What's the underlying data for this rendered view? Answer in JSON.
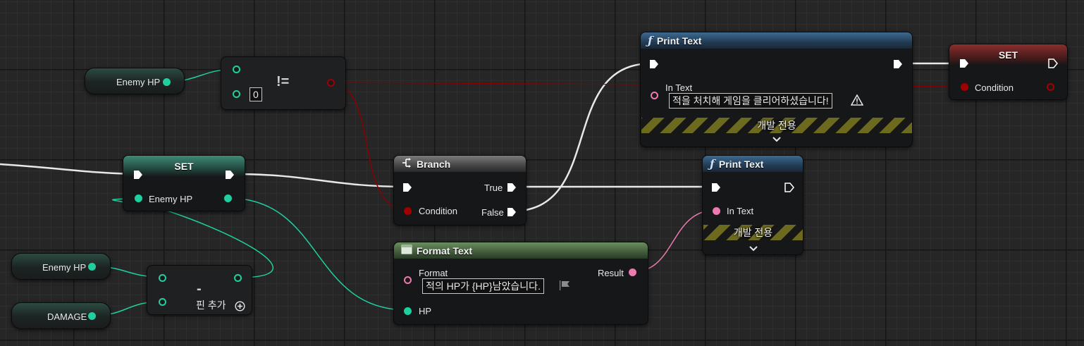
{
  "nodes": {
    "get_enemy_hp_top": {
      "label": "Enemy HP"
    },
    "not_equal": {
      "symbol": "!=",
      "b_value": "0"
    },
    "print_text_top": {
      "title": "Print Text",
      "in_text_label": "In Text",
      "in_text_value": "적을 처치해 게임을 클리어하셨습니다!",
      "dev_only": "개발 전용",
      "icon": "warning-icon"
    },
    "set_condition": {
      "title": "SET",
      "pin_label": "Condition"
    },
    "set_enemy_hp": {
      "title": "SET",
      "pin_label": "Enemy HP"
    },
    "branch": {
      "title": "Branch",
      "condition_label": "Condition",
      "true_label": "True",
      "false_label": "False"
    },
    "print_text_bottom": {
      "title": "Print Text",
      "in_text_label": "In Text",
      "dev_only": "개발 전용"
    },
    "format_text": {
      "title": "Format Text",
      "format_label": "Format",
      "format_value": "적의 HP가 {HP}남았습니다.",
      "result_label": "Result",
      "hp_label": "HP"
    },
    "get_enemy_hp_bottom": {
      "label": "Enemy HP"
    },
    "get_damage": {
      "label": "DAMAGE"
    },
    "subtract": {
      "symbol": "-",
      "add_pin_label": "핀 추가"
    }
  },
  "colors": {
    "exec_wire": "#ffffff",
    "int_wire": "#1ed0a0",
    "bool_wire": "#a00000",
    "text_wire": "#ea7ab0",
    "function_header": "#3d6a91",
    "format_header": "#6a8e5e"
  }
}
